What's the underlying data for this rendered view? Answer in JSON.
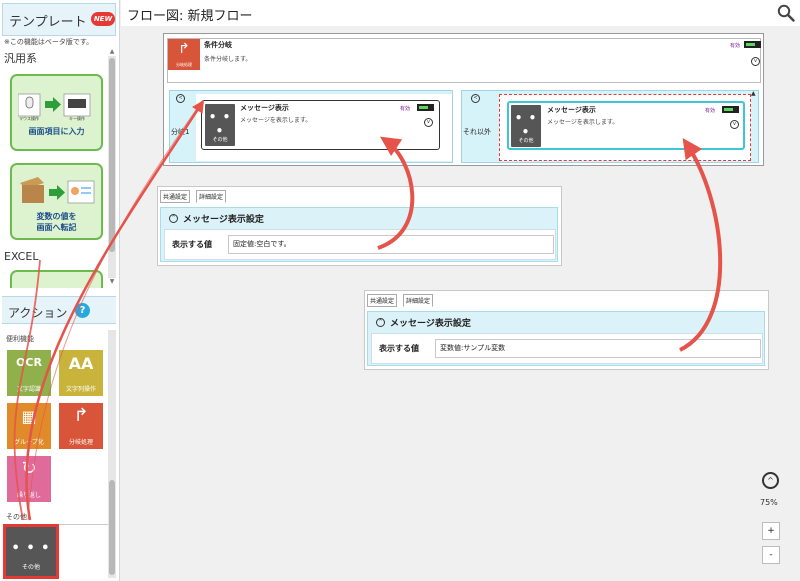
{
  "sidebar": {
    "template_header": "テンプレート",
    "new_badge": "NEW",
    "beta_note": "※この機能はベータ版です。",
    "category_general": "汎用系",
    "category_excel": "EXCEL",
    "templates": [
      {
        "label_line1": "画面項目に入力",
        "label_line2": "",
        "icon_left_caption": "マウス操作",
        "icon_right_caption": "キー操作"
      },
      {
        "label_line1": "変数の値を",
        "label_line2": "画面へ転記"
      }
    ],
    "actions_header": "アクション",
    "help_glyph": "?",
    "actions_sub": "便利機能",
    "actions": [
      {
        "label": "文字認識",
        "glyph": "OCR",
        "color": "#8fb04b"
      },
      {
        "label": "文字列操作",
        "glyph": "AA",
        "color": "#c9b33a"
      },
      {
        "label": "グループ化",
        "glyph": "▦",
        "color": "#e08a2a"
      },
      {
        "label": "分岐処理",
        "glyph": "↱",
        "color": "#d8553a"
      },
      {
        "label": "繰り返し",
        "glyph": "↻",
        "color": "#e06a9a"
      }
    ],
    "other_category": "その他",
    "other_tile": {
      "label": "その他",
      "glyph": "• • •"
    }
  },
  "topbar": {
    "title": "フロー図:  新規フロー"
  },
  "flow": {
    "condition_node": {
      "title": "条件分岐",
      "status": "有効",
      "description": "条件分岐します。",
      "icon_caption": "分岐処理"
    },
    "branches": [
      {
        "label": "分岐1",
        "node": {
          "title": "メッセージ表示",
          "status": "有効",
          "description": "メッセージを表示します。",
          "icon_caption": "その他",
          "icon_glyph": "• • •"
        }
      },
      {
        "label": "それ以外",
        "node": {
          "title": "メッセージ表示",
          "status": "有効",
          "description": "メッセージを表示します。",
          "icon_caption": "その他",
          "icon_glyph": "• • •"
        }
      }
    ]
  },
  "properties": [
    {
      "tab_common": "共通設定",
      "tab_detail": "詳細設定",
      "section_title": "メッセージ表示設定",
      "field_label": "表示する値",
      "field_value": "固定値:空白です。"
    },
    {
      "tab_common": "共通設定",
      "tab_detail": "詳細設定",
      "section_title": "メッセージ表示設定",
      "field_label": "表示する値",
      "field_value": "変数値:サンプル変数"
    }
  ],
  "zoom": {
    "level": "75%",
    "plus": "+",
    "minus": "-",
    "up_glyph": "^"
  },
  "colors": {
    "accent": "#29a8e0",
    "highlight_red": "#e53935",
    "template_green": "#6dbb4f",
    "branch_bg": "#d7f3fa"
  }
}
